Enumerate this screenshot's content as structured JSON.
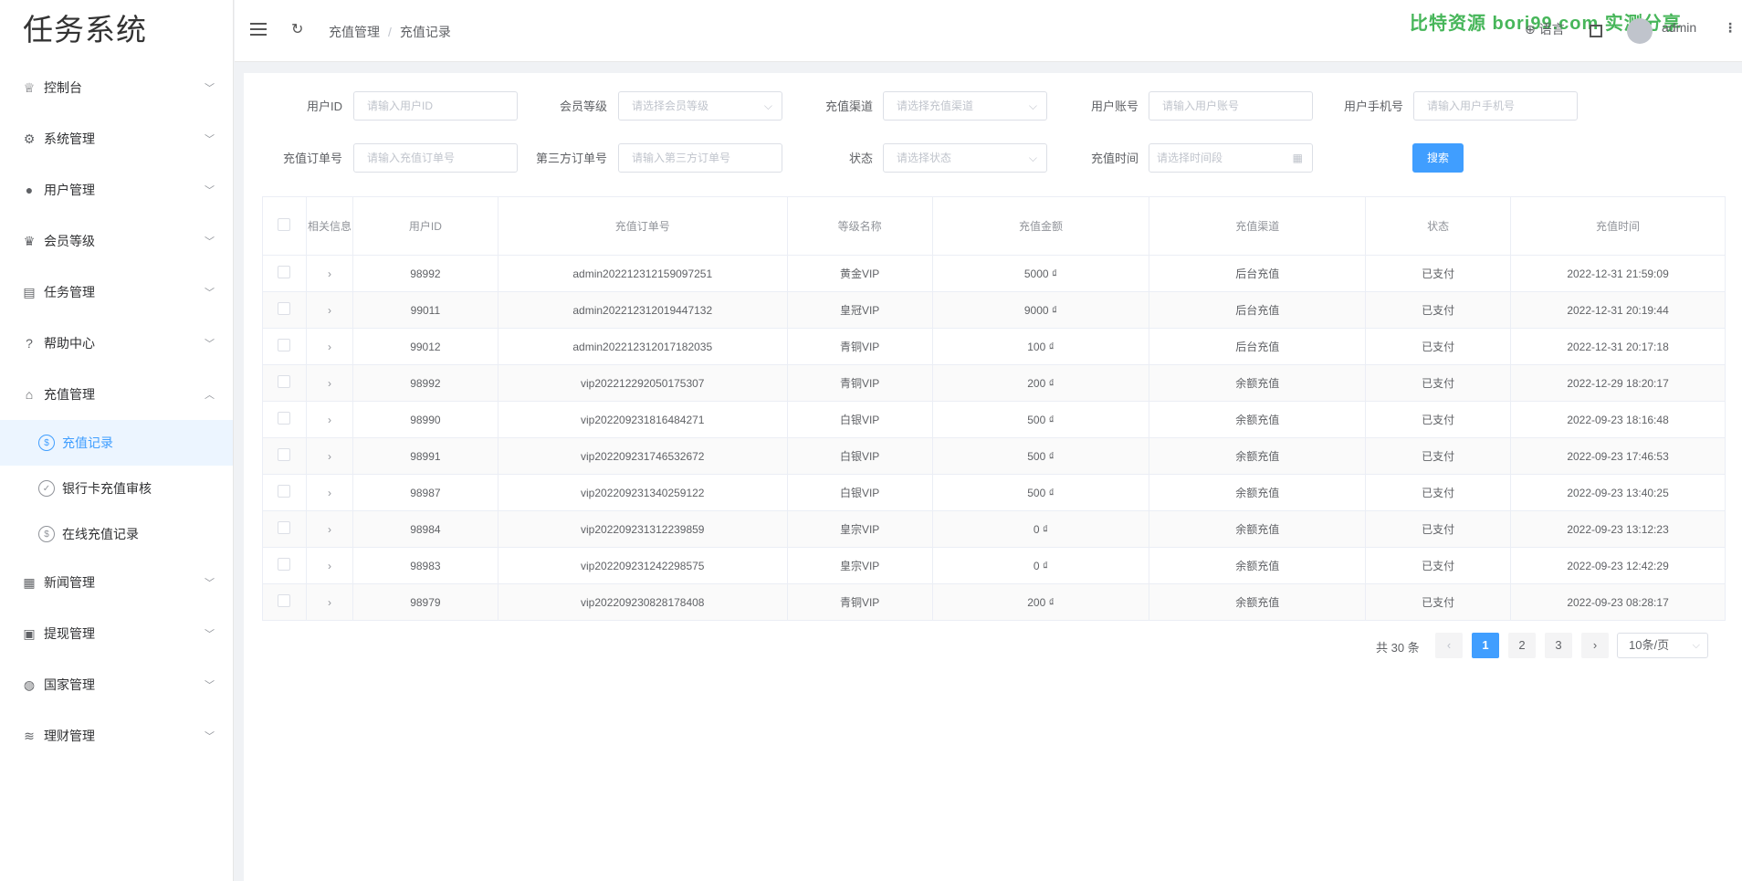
{
  "app": {
    "title": "任务系统"
  },
  "sidebar": {
    "items": [
      {
        "label": "控制台",
        "icon": "trophy-icon"
      },
      {
        "label": "系统管理",
        "icon": "gear-icon"
      },
      {
        "label": "用户管理",
        "icon": "user-icon"
      },
      {
        "label": "会员等级",
        "icon": "crown-icon"
      },
      {
        "label": "任务管理",
        "icon": "clipboard-icon"
      },
      {
        "label": "帮助中心",
        "icon": "question-icon"
      },
      {
        "label": "充值管理",
        "icon": "bank-icon"
      },
      {
        "label": "新闻管理",
        "icon": "news-icon"
      },
      {
        "label": "提现管理",
        "icon": "wallet-icon"
      },
      {
        "label": "国家管理",
        "icon": "globe-icon"
      },
      {
        "label": "理财管理",
        "icon": "coins-icon"
      }
    ],
    "sub_items": [
      {
        "label": "充值记录",
        "active": true
      },
      {
        "label": "银行卡充值审核",
        "active": false
      },
      {
        "label": "在线充值记录",
        "active": false
      }
    ]
  },
  "header": {
    "breadcrumb": [
      "充值管理",
      "充值记录"
    ],
    "watermark": "比特资源 bori99.com 实测分享",
    "language": "语言",
    "user": "admin"
  },
  "filters": {
    "user_id": {
      "label": "用户ID",
      "placeholder": "请输入用户ID"
    },
    "member_level": {
      "label": "会员等级",
      "placeholder": "请选择会员等级"
    },
    "channel": {
      "label": "充值渠道",
      "placeholder": "请选择充值渠道"
    },
    "account": {
      "label": "用户账号",
      "placeholder": "请输入用户账号"
    },
    "phone": {
      "label": "用户手机号",
      "placeholder": "请输入用户手机号"
    },
    "order_no": {
      "label": "充值订单号",
      "placeholder": "请输入充值订单号"
    },
    "third_order_no": {
      "label": "第三方订单号",
      "placeholder": "请输入第三方订单号"
    },
    "status": {
      "label": "状态",
      "placeholder": "请选择状态"
    },
    "time": {
      "label": "充值时间",
      "placeholder": "请选择时间段"
    },
    "search_label": "搜索"
  },
  "table": {
    "columns": [
      "相关信息",
      "用户ID",
      "充值订单号",
      "等级名称",
      "充值金额",
      "充值渠道",
      "状态",
      "充值时间"
    ],
    "rows": [
      {
        "user_id": "98992",
        "order": "admin202212312159097251",
        "level": "黄金VIP",
        "amount": "5000 ₫",
        "channel": "后台充值",
        "status": "已支付",
        "time": "2022-12-31 21:59:09"
      },
      {
        "user_id": "99011",
        "order": "admin202212312019447132",
        "level": "皇冠VIP",
        "amount": "9000 ₫",
        "channel": "后台充值",
        "status": "已支付",
        "time": "2022-12-31 20:19:44"
      },
      {
        "user_id": "99012",
        "order": "admin202212312017182035",
        "level": "青铜VIP",
        "amount": "100 ₫",
        "channel": "后台充值",
        "status": "已支付",
        "time": "2022-12-31 20:17:18"
      },
      {
        "user_id": "98992",
        "order": "vip202212292050175307",
        "level": "青铜VIP",
        "amount": "200 ₫",
        "channel": "余额充值",
        "status": "已支付",
        "time": "2022-12-29 18:20:17"
      },
      {
        "user_id": "98990",
        "order": "vip202209231816484271",
        "level": "白银VIP",
        "amount": "500 ₫",
        "channel": "余额充值",
        "status": "已支付",
        "time": "2022-09-23 18:16:48"
      },
      {
        "user_id": "98991",
        "order": "vip202209231746532672",
        "level": "白银VIP",
        "amount": "500 ₫",
        "channel": "余额充值",
        "status": "已支付",
        "time": "2022-09-23 17:46:53"
      },
      {
        "user_id": "98987",
        "order": "vip202209231340259122",
        "level": "白银VIP",
        "amount": "500 ₫",
        "channel": "余额充值",
        "status": "已支付",
        "time": "2022-09-23 13:40:25"
      },
      {
        "user_id": "98984",
        "order": "vip202209231312239859",
        "level": "皇宗VIP",
        "amount": "0 ₫",
        "channel": "余额充值",
        "status": "已支付",
        "time": "2022-09-23 13:12:23"
      },
      {
        "user_id": "98983",
        "order": "vip202209231242298575",
        "level": "皇宗VIP",
        "amount": "0 ₫",
        "channel": "余额充值",
        "status": "已支付",
        "time": "2022-09-23 12:42:29"
      },
      {
        "user_id": "98979",
        "order": "vip202209230828178408",
        "level": "青铜VIP",
        "amount": "200 ₫",
        "channel": "余额充值",
        "status": "已支付",
        "time": "2022-09-23 08:28:17"
      }
    ]
  },
  "pagination": {
    "total_label": "共 30 条",
    "pages": [
      "1",
      "2",
      "3"
    ],
    "current": "1",
    "prev": "‹",
    "next": "›",
    "page_size": "10条/页"
  },
  "colors": {
    "primary": "#409eff",
    "watermark": "#47b65a"
  }
}
